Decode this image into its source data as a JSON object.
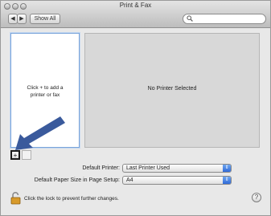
{
  "window": {
    "title": "Print & Fax"
  },
  "toolbar": {
    "back": "◀",
    "forward": "▶",
    "show_all": "Show All",
    "search_placeholder": ""
  },
  "printer_list": {
    "hint_line1": "Click + to add a",
    "hint_line2": "printer or fax"
  },
  "detail": {
    "message": "No Printer Selected"
  },
  "list_buttons": {
    "add": "+",
    "remove": ""
  },
  "settings": {
    "default_printer_label": "Default Printer:",
    "default_printer_value": "Last Printer Used",
    "paper_size_label": "Default Paper Size in Page Setup:",
    "paper_size_value": "A4"
  },
  "footer": {
    "lock_text": "Click the lock to prevent further changes.",
    "help": "?"
  },
  "colors": {
    "arrow": "#3a5a9c",
    "accent": "#2f6ad8"
  }
}
